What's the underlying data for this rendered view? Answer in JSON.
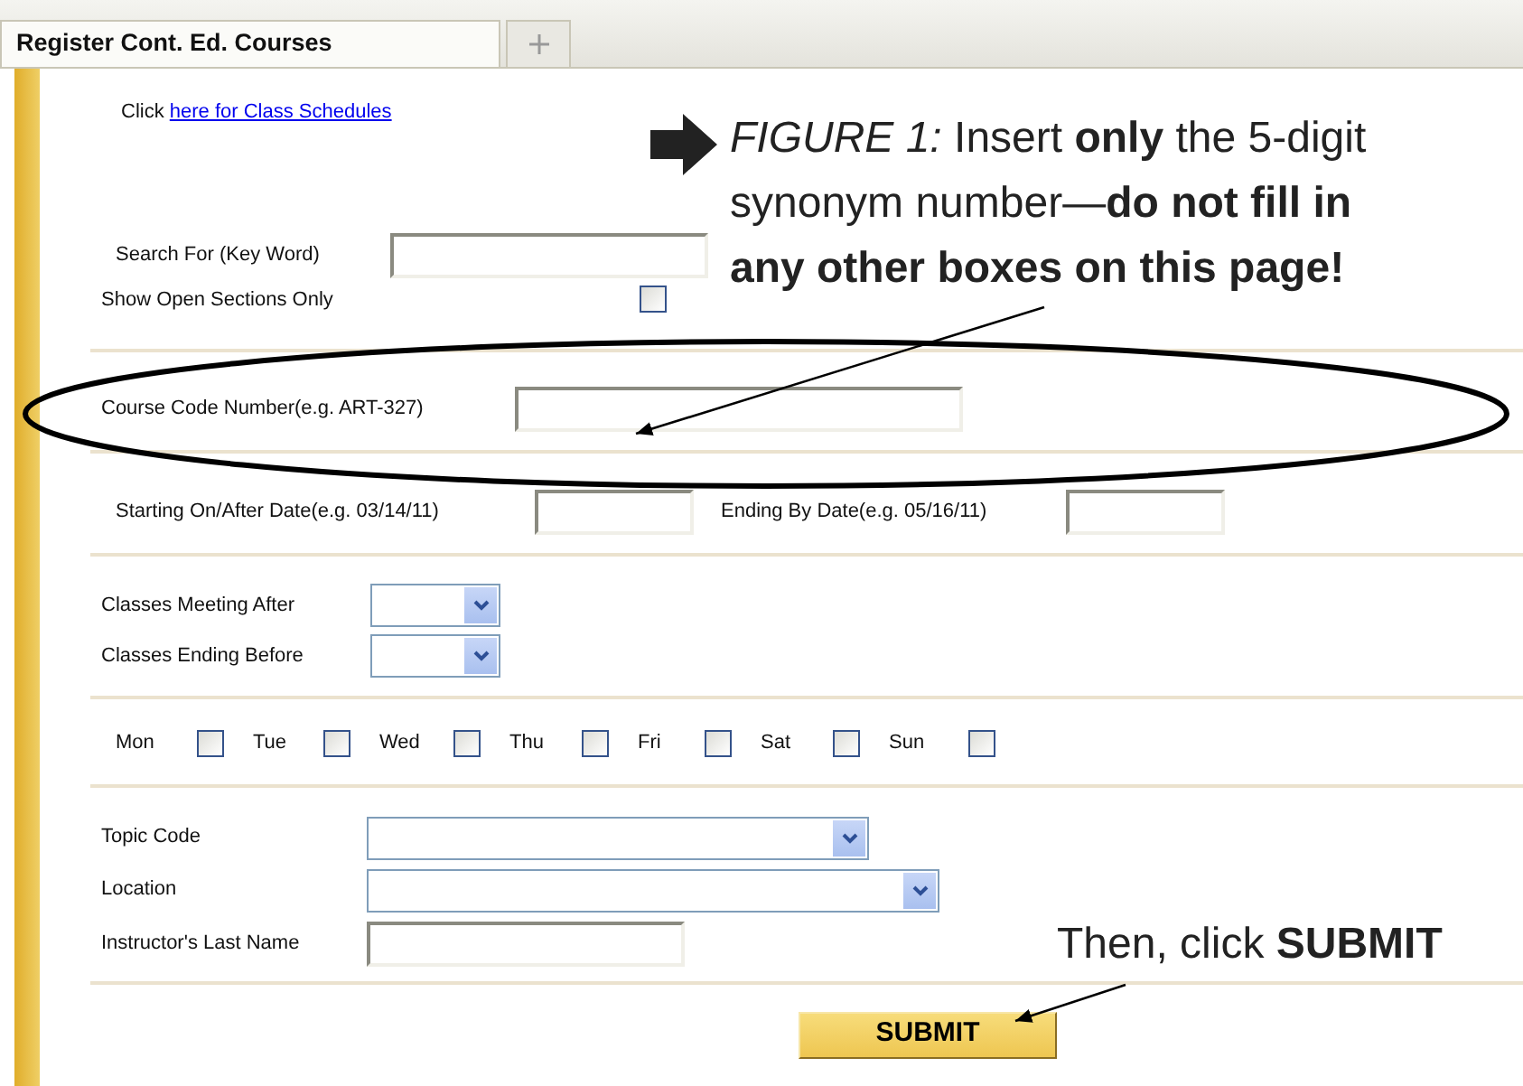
{
  "tabs": [
    {
      "title": "Register Cont. Ed. Courses",
      "selected": true
    },
    {
      "kind": "new",
      "selected": false
    }
  ],
  "schedule_link": {
    "prefix": "Click",
    "link": "here for Class Schedules"
  },
  "search": {
    "label": "Search For (Key Word)"
  },
  "open_sections": {
    "label": "Show Open Sections Only",
    "checked": false
  },
  "course_code": {
    "label": "Course Code Number(e.g. ART-327)"
  },
  "dates": {
    "start_label": "Starting On/After Date(e.g. 03/14/11)",
    "end_label": "Ending By Date(e.g. 05/16/11)"
  },
  "times": [
    {
      "label": "Classes Meeting After"
    },
    {
      "label": "Classes Ending Before"
    }
  ],
  "days": [
    {
      "label": "Mon",
      "checked": false
    },
    {
      "label": "Tue",
      "checked": false
    },
    {
      "label": "Wed",
      "checked": false
    },
    {
      "label": "Thu",
      "checked": false
    },
    {
      "label": "Fri",
      "checked": false
    },
    {
      "label": "Sat",
      "checked": false
    },
    {
      "label": "Sun",
      "checked": false
    }
  ],
  "filters": [
    {
      "kind": "select",
      "label": "Topic Code"
    },
    {
      "kind": "select",
      "label": "Location"
    },
    {
      "kind": "text",
      "label": "Instructor's Last Name"
    }
  ],
  "submit": "SUBMIT",
  "annotations": {
    "callout": "*FIGURE 1:* Insert **only** the 5-digit synonym number—**do not fill in any other boxes on this page!**",
    "then": "Then, click **SUBMIT**"
  }
}
